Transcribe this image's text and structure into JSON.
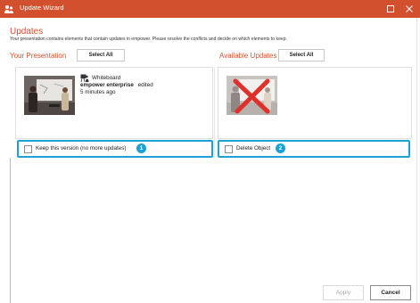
{
  "window": {
    "title": "Update Wizard",
    "maximize_icon": "maximize-icon",
    "close_icon": "close-icon"
  },
  "header": {
    "title": "Updates",
    "description": "Your presentation contains elements that contain updates in empower. Please resolve the conflicts and decide on which elements to keep."
  },
  "left": {
    "title": "Your Presentation",
    "select_all": "Select All",
    "item": {
      "type_icon": "whiteboard-icon",
      "type": "Whiteboard",
      "author": "empower enterprise",
      "action": "edited",
      "time": "5 minutes ago"
    },
    "option_label": "Keep this version (no more updates)",
    "option_checked": false,
    "badge": "1"
  },
  "right": {
    "title": "Available Updates",
    "select_all": "Select All",
    "option_label": "Delete Object",
    "option_checked": false,
    "badge": "2"
  },
  "footer": {
    "apply": "Apply",
    "cancel": "Cancel"
  },
  "colors": {
    "accent": "#d2502d",
    "highlight": "#1ba1d6",
    "delete_mark": "#e0302c"
  }
}
